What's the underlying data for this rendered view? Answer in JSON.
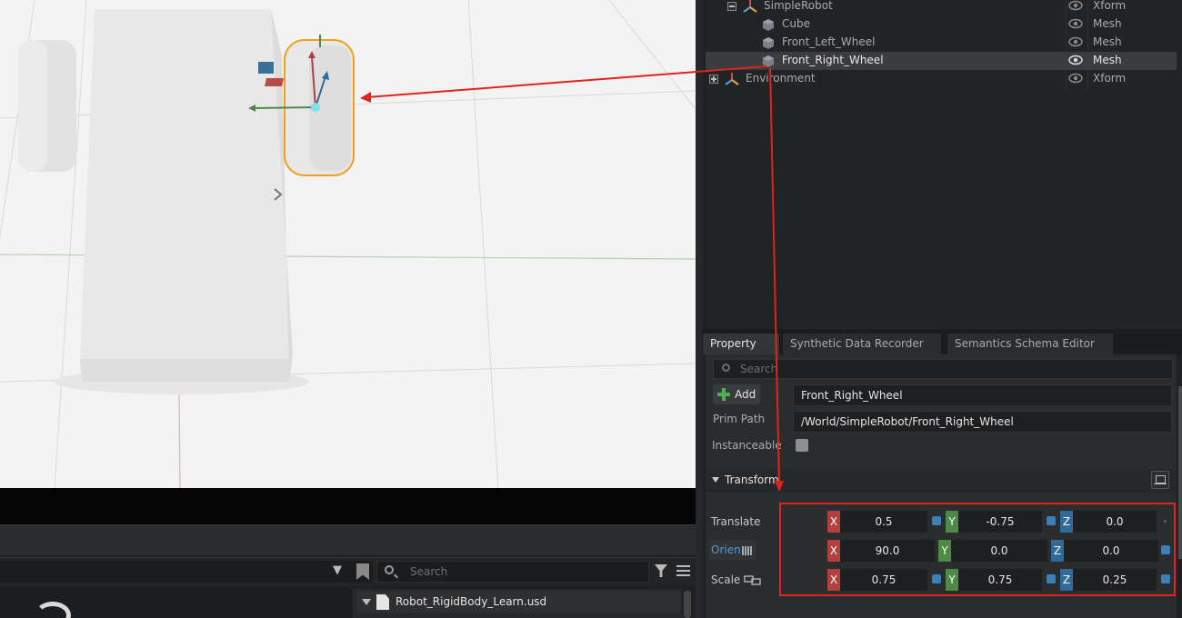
{
  "stage": {
    "rows": [
      {
        "label": "SimpleRobot",
        "type": "Xform"
      },
      {
        "label": "Cube",
        "type": "Mesh"
      },
      {
        "label": "Front_Left_Wheel",
        "type": "Mesh"
      },
      {
        "label": "Front_Right_Wheel",
        "type": "Mesh",
        "selected": true
      },
      {
        "label": "Environment",
        "type": "Xform"
      }
    ]
  },
  "property": {
    "tabs": [
      "Property",
      "Synthetic Data Recorder",
      "Semantics Schema Editor"
    ],
    "search_placeholder": "Search",
    "add_label": "Add",
    "name_value": "Front_Right_Wheel",
    "prim_path_label": "Prim Path",
    "prim_path_value": "/World/SimpleRobot/Front_Right_Wheel",
    "instanceable_label": "Instanceable",
    "transform_label": "Transform",
    "translate_label": "Translate",
    "orient_label": "Orien",
    "scale_label": "Scale",
    "axis_labels": [
      "X",
      "Y",
      "Z"
    ],
    "translate": [
      "0.5",
      "-0.75",
      "0.0"
    ],
    "orient": [
      "90.0",
      "0.0",
      "0.0"
    ],
    "scale": [
      "0.75",
      "0.75",
      "0.25"
    ]
  },
  "content_browser": {
    "search_placeholder": "Search",
    "file_name": "Robot_RigidBody_Learn.usd"
  },
  "colors": {
    "annotation": "#e0241d",
    "selection_outline": "#f0a020",
    "axis_x": "#b33f3f",
    "axis_y": "#4e8a45",
    "axis_z": "#2f6b99"
  }
}
